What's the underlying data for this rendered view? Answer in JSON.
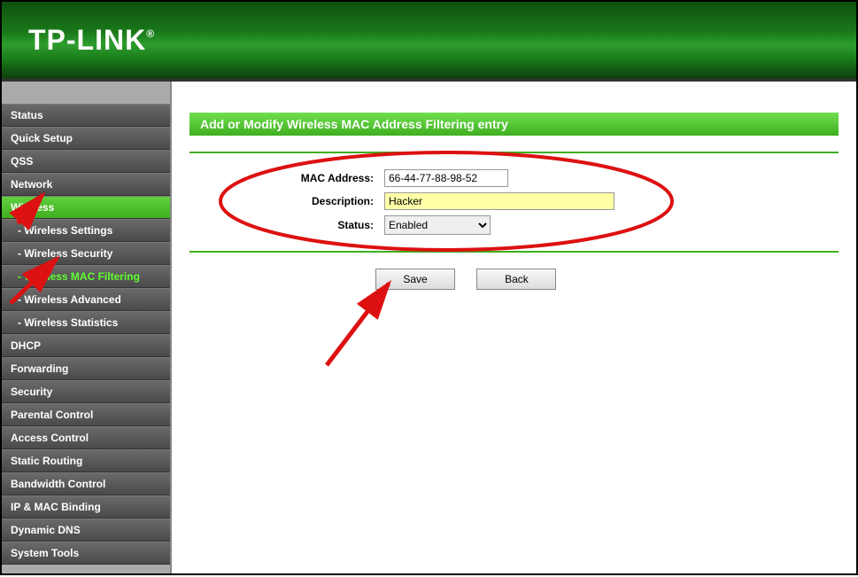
{
  "brand": "TP-LINK",
  "sidebar": {
    "items": [
      {
        "label": "Status"
      },
      {
        "label": "Quick Setup"
      },
      {
        "label": "QSS"
      },
      {
        "label": "Network"
      },
      {
        "label": "Wireless",
        "active": true
      },
      {
        "label": "- Wireless Settings",
        "sub": true
      },
      {
        "label": "- Wireless Security",
        "sub": true
      },
      {
        "label": "- Wireless MAC Filtering",
        "sub": true,
        "activeSub": true
      },
      {
        "label": "- Wireless Advanced",
        "sub": true
      },
      {
        "label": "- Wireless Statistics",
        "sub": true
      },
      {
        "label": "DHCP"
      },
      {
        "label": "Forwarding"
      },
      {
        "label": "Security"
      },
      {
        "label": "Parental Control"
      },
      {
        "label": "Access Control"
      },
      {
        "label": "Static Routing"
      },
      {
        "label": "Bandwidth Control"
      },
      {
        "label": "IP & MAC Binding"
      },
      {
        "label": "Dynamic DNS"
      },
      {
        "label": "System Tools"
      }
    ]
  },
  "page": {
    "title": "Add or Modify Wireless MAC Address Filtering entry",
    "labels": {
      "mac": "MAC Address:",
      "desc": "Description:",
      "status": "Status:"
    },
    "values": {
      "mac": "66-44-77-88-98-52",
      "desc": "Hacker",
      "status": "Enabled"
    },
    "buttons": {
      "save": "Save",
      "back": "Back"
    }
  }
}
